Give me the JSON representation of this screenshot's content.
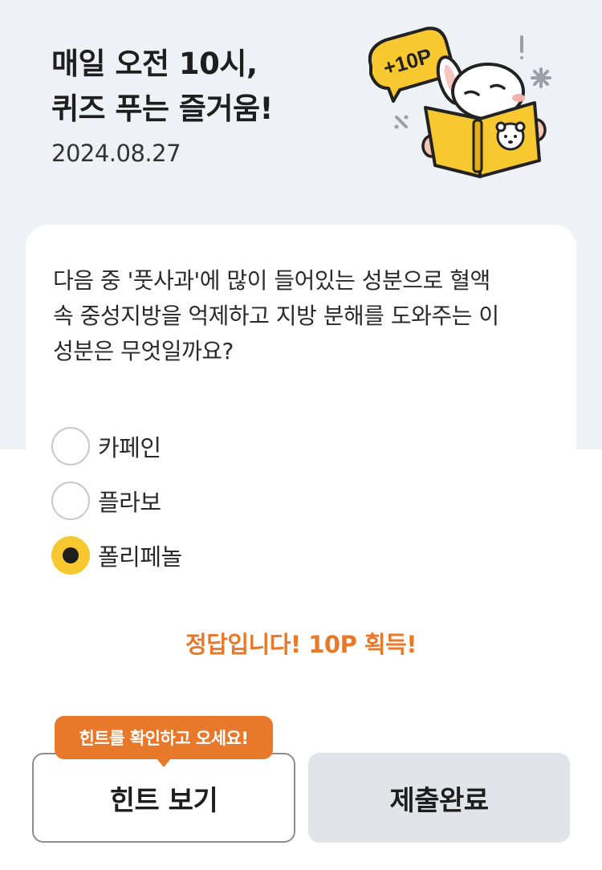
{
  "header": {
    "title_line1": "매일 오전 10시,",
    "title_line2": "퀴즈 푸는 즐거움!",
    "date": "2024.08.27",
    "badge": "+10P"
  },
  "quiz": {
    "question_line1": "다음 중 '풋사과'에 많이 들어있는 성분으로 혈액",
    "question_line2": "속 중성지방을 억제하고 지방 분해를 도와주는 이",
    "question_line3": "성분은 무엇일까요?",
    "options": [
      {
        "label": "카페인",
        "selected": false
      },
      {
        "label": "플라보",
        "selected": false
      },
      {
        "label": "폴리페놀",
        "selected": true
      }
    ],
    "result": "정답입니다! 10P 획득!"
  },
  "actions": {
    "tooltip": "힌트를 확인하고 오세요!",
    "hint_label": "힌트 보기",
    "submit_label": "제출완료"
  },
  "colors": {
    "accent_orange": "#e8792b",
    "accent_yellow": "#f7c82f",
    "background_top": "#eef1f6"
  }
}
